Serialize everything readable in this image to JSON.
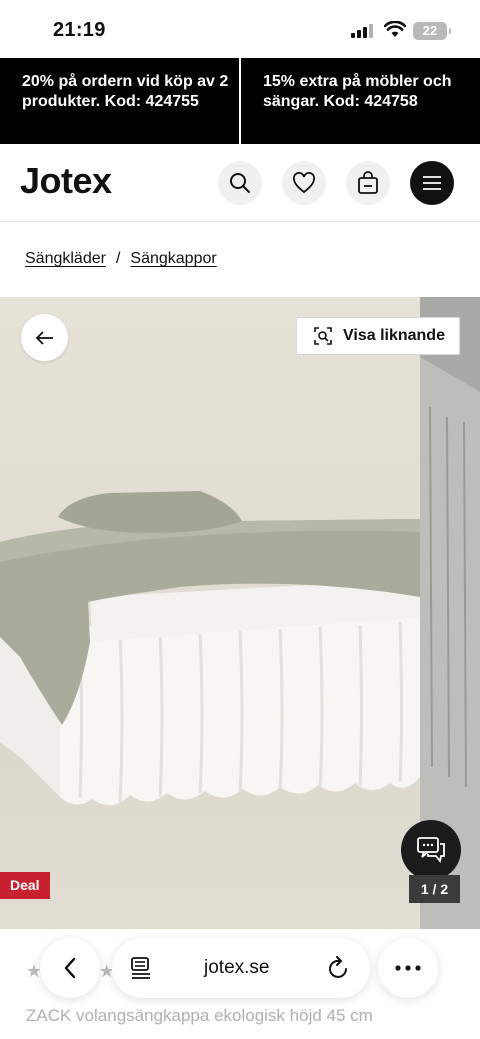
{
  "status": {
    "time": "21:19",
    "battery": "22"
  },
  "promo": [
    {
      "text": "20% på ordern vid köp av 2 produkter. Kod: 424755"
    },
    {
      "text": "15% extra på möbler och sängar. Kod: 424758"
    }
  ],
  "header": {
    "logo": "Jotex",
    "icons": [
      "search-icon",
      "heart-icon",
      "bag-icon",
      "menu-icon"
    ]
  },
  "breadcrumb": {
    "items": [
      "Sängkläder",
      "Sängkappor"
    ],
    "separator": "/"
  },
  "hero": {
    "similar_label": "Visa liknande",
    "deal_label": "Deal",
    "counter": "1 / 2"
  },
  "product": {
    "title": "ZACK volangsängkappa ekologisk höjd 45 cm"
  },
  "browser": {
    "url": "jotex.se"
  },
  "colors": {
    "promo_bg": "#000000",
    "deal_bg": "#c8202f",
    "menu_btn": "#111111"
  }
}
